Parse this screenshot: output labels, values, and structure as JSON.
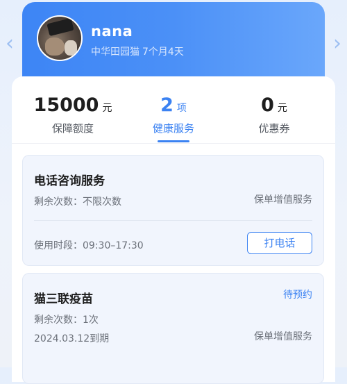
{
  "pet": {
    "name": "nana",
    "breed": "中华田园猫",
    "age": "7个月4天"
  },
  "stats": [
    {
      "value": "15000",
      "unit": "元",
      "label": "保障额度",
      "active": false
    },
    {
      "value": "2",
      "unit": "项",
      "label": "健康服务",
      "active": true
    },
    {
      "value": "0",
      "unit": "元",
      "label": "优惠券",
      "active": false
    }
  ],
  "services": [
    {
      "title": "电话咨询服务",
      "remaining": "剩余次数：不限次数",
      "tag": "保单增值服务",
      "hours": "使用时段：09:30–17:30",
      "action_label": "打电话"
    },
    {
      "title": "猫三联疫苗",
      "status": "待预约",
      "remaining": "剩余次数：1次",
      "expiry": "2024.03.12到期",
      "tag": "保单增值服务"
    }
  ],
  "icons": {
    "prev": "chevron-left-icon",
    "next": "chevron-right-icon"
  },
  "colors": {
    "accent": "#3b82f2",
    "header_gradient_start": "#3d85f5",
    "header_gradient_end": "#6aa7fb"
  }
}
